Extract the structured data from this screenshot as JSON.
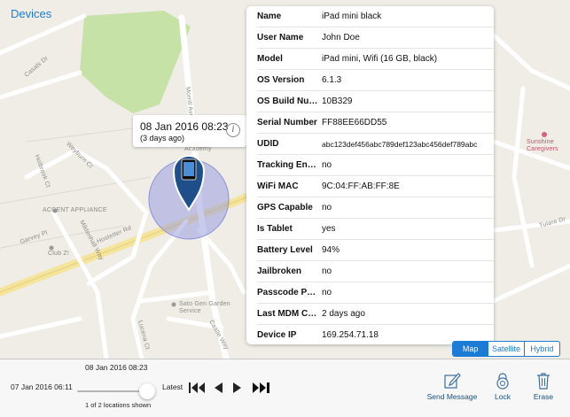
{
  "nav": {
    "back_label": "Devices"
  },
  "map_labels": {
    "casals_dr": "Casals Dr",
    "morrill_ave": "Morrill Ave",
    "hostetter_rd": "Hostetter Rd",
    "ascent_appliance": "ACCENT APPLIANCE",
    "club_z": "Club Z!",
    "berryessa_academy": "Berryessa Academy",
    "sato_gen": "Sato Gen Garden Service",
    "sunshine_caregivers": "Sunshine Caregivers",
    "holbrook_ct": "Holbrook Ct",
    "garvey_pl": "Garvey Pl",
    "mildenhall_way": "Mildenhall Way",
    "weyburn_ct": "Weyburn Ct",
    "lucena_ct": "Lucena Ct",
    "castle_way": "Castle Way",
    "tulare_dr": "Tulare Dr"
  },
  "callout": {
    "timestamp": "08 Jan 2016 08:23",
    "relative": "(3 days ago)",
    "info_glyph": "i"
  },
  "details": [
    {
      "label": "Name",
      "value": "iPad mini black"
    },
    {
      "label": "User Name",
      "value": "John Doe"
    },
    {
      "label": "Model",
      "value": "iPad mini, Wifi (16 GB, black)"
    },
    {
      "label": "OS Version",
      "value": "6.1.3"
    },
    {
      "label": "OS Build Num...",
      "value": "10B329"
    },
    {
      "label": "Serial Number",
      "value": "FF88EE66DD55"
    },
    {
      "label": "UDID",
      "value": "abc123def456abc789def123abc456def789abc"
    },
    {
      "label": "Tracking Enab...",
      "value": "no"
    },
    {
      "label": "WiFi MAC",
      "value": "9C:04:FF:AB:FF:8E"
    },
    {
      "label": "GPS Capable",
      "value": "no"
    },
    {
      "label": "Is Tablet",
      "value": "yes"
    },
    {
      "label": "Battery Level",
      "value": "94%"
    },
    {
      "label": "Jailbroken",
      "value": "no"
    },
    {
      "label": "Passcode Pre...",
      "value": "no"
    },
    {
      "label": "Last MDM Co...",
      "value": "2 days ago"
    },
    {
      "label": "Device IP",
      "value": "169.254.71.18"
    }
  ],
  "map_type": {
    "options": [
      "Map",
      "Satellite",
      "Hybrid"
    ],
    "selected": "Map"
  },
  "timeline": {
    "current": "08 Jan 2016 08:23",
    "start": "07 Jan 2016 06:11",
    "end_label": "Latest",
    "count": "1 of 2 locations shown"
  },
  "actions": {
    "send_message": "Send Message",
    "lock": "Lock",
    "erase": "Erase"
  },
  "icons": {
    "back": "back-icon",
    "info": "info-icon",
    "first": "skip-first-icon",
    "prev": "prev-icon",
    "next": "next-icon",
    "last": "skip-last-icon",
    "compose": "compose-icon",
    "lock": "lock-icon",
    "trash": "trash-icon"
  },
  "colors": {
    "accent": "#1d7bd8",
    "park": "#c6e2a7",
    "road": "#ffffff",
    "highway": "#f5e49c",
    "accuracy": "#9a9ee0"
  }
}
